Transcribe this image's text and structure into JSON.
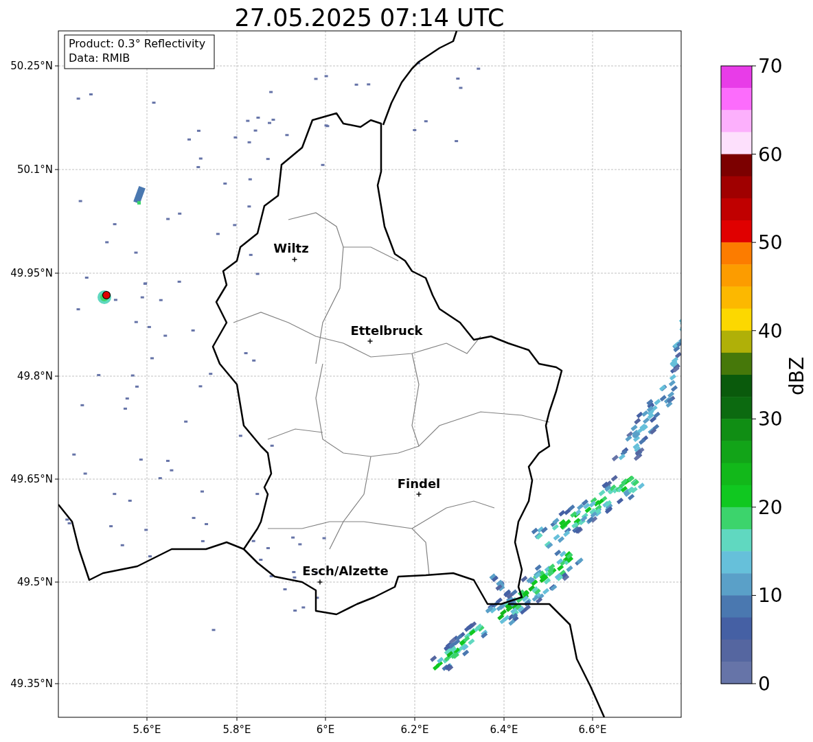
{
  "title": "27.05.2025 07:14 UTC",
  "info_box": [
    "Product: 0.3° Reflectivity",
    "Data: RMIB"
  ],
  "y_ticks": [
    "50.25°N",
    "50.1°N",
    "49.95°N",
    "49.8°N",
    "49.65°N",
    "49.5°N",
    "49.35°N"
  ],
  "x_ticks": [
    "5.6°E",
    "5.8°E",
    "6°E",
    "6.2°E",
    "6.4°E",
    "6.6°E"
  ],
  "cities": [
    {
      "name": "Wiltz"
    },
    {
      "name": "Ettelbruck"
    },
    {
      "name": "Findel"
    },
    {
      "name": "Esch/Alzette"
    }
  ],
  "colorbar": {
    "label": "dBZ",
    "ticks": [
      "70",
      "60",
      "50",
      "40",
      "30",
      "20",
      "10",
      "0"
    ],
    "segments": [
      {
        "color": "#e83ce8"
      },
      {
        "color": "#fc6cfc"
      },
      {
        "color": "#fcb0fc"
      },
      {
        "color": "#fde0fc"
      },
      {
        "color": "#7c0000"
      },
      {
        "color": "#a00000"
      },
      {
        "color": "#c00000"
      },
      {
        "color": "#e00000"
      },
      {
        "color": "#fc7c00"
      },
      {
        "color": "#fc9c00"
      },
      {
        "color": "#fcb800"
      },
      {
        "color": "#fcd800"
      },
      {
        "color": "#b0b008"
      },
      {
        "color": "#46780a"
      },
      {
        "color": "#0a5a0c"
      },
      {
        "color": "#0c6a10"
      },
      {
        "color": "#108e14"
      },
      {
        "color": "#12a418"
      },
      {
        "color": "#12b81a"
      },
      {
        "color": "#10c820"
      },
      {
        "color": "#3cd46c"
      },
      {
        "color": "#60d8c0"
      },
      {
        "color": "#66c0da"
      },
      {
        "color": "#5aa0c8"
      },
      {
        "color": "#4a78b0"
      },
      {
        "color": "#4560a4"
      },
      {
        "color": "#5566a0"
      },
      {
        "color": "#6674a8"
      }
    ]
  }
}
